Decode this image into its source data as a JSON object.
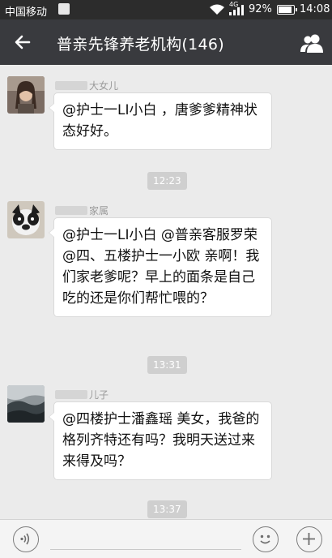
{
  "status_bar": {
    "carrier": "中国移动",
    "network": "4G",
    "battery": "92%",
    "time": "14:08"
  },
  "header": {
    "title": "普亲先锋养老机构(146)"
  },
  "messages": [
    {
      "sender": "大女儿",
      "text": "@护士一LI小白 ，唐爹爹精神状态好好。"
    },
    {
      "sender": "家属",
      "text": "@护士一LI小白 @普亲客服罗荣 @四、五楼护士一小欧 亲啊！我们家老爹呢？早上的面条是自己吃的还是你们帮忙喂的？"
    },
    {
      "sender": "儿子",
      "text": "@四楼护士潘鑫瑶 美女，我爸的格列齐特还有吗？我明天送过来来得及吗？"
    }
  ],
  "timestamps": [
    "12:23",
    "13:31",
    "13:37"
  ],
  "colors": {
    "header_bg": "#393a3e",
    "status_bg": "#2c2c2c",
    "chat_bg": "#ebebeb",
    "timestamp_bg": "#cfcfcf"
  }
}
